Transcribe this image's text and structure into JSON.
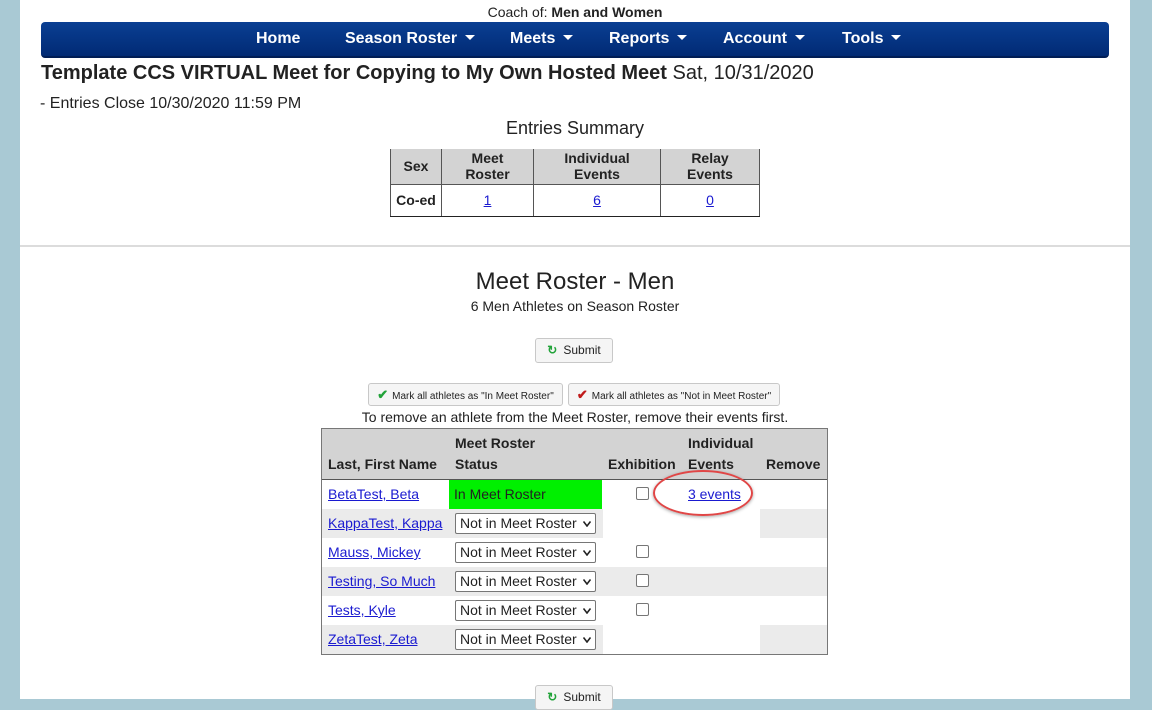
{
  "header": {
    "coach_prefix": "Coach of:",
    "coach_value": "Men and Women"
  },
  "nav": {
    "items": [
      {
        "label": "Home",
        "dropdown": false
      },
      {
        "label": "Season Roster",
        "dropdown": true
      },
      {
        "label": "Meets",
        "dropdown": true
      },
      {
        "label": "Reports",
        "dropdown": true
      },
      {
        "label": "Account",
        "dropdown": true
      },
      {
        "label": "Tools",
        "dropdown": true
      }
    ]
  },
  "meet": {
    "title": "Template CCS VIRTUAL Meet for Copying to My Own Hosted Meet",
    "date": "Sat, 10/31/2020",
    "entries_close": "- Entries Close 10/30/2020 11:59 PM"
  },
  "summary": {
    "title": "Entries Summary",
    "headers": [
      "Sex",
      "Meet Roster",
      "Individual Events",
      "Relay Events"
    ],
    "row": {
      "sex": "Co-ed",
      "meet_roster": "1",
      "individual_events": "6",
      "relay_events": "0"
    }
  },
  "roster": {
    "title": "Meet Roster - Men",
    "subtitle": "6 Men Athletes on Season Roster",
    "submit_label": "Submit",
    "mark_in_label": "Mark all athletes as \"In Meet Roster\"",
    "mark_out_label": "Mark all athletes as \"Not in Meet Roster\"",
    "remove_note": "To remove an athlete from the Meet Roster, remove their events first.",
    "columns": {
      "name": "Last, First Name",
      "status_line1": "Meet Roster",
      "status_line2": "Status",
      "exhibition": "Exhibition",
      "events_line1": "Individual",
      "events_line2": "Events",
      "remove": "Remove"
    },
    "athletes": [
      {
        "name": "BetaTest, Beta",
        "status": "In Meet Roster",
        "events": "3 events"
      },
      {
        "name": "KappaTest, Kappa",
        "status": "Not in Meet Roster",
        "events": ""
      },
      {
        "name": "Mauss, Mickey",
        "status": "Not in Meet Roster",
        "events": ""
      },
      {
        "name": "Testing, So Much",
        "status": "Not in Meet Roster",
        "events": ""
      },
      {
        "name": "Tests, Kyle",
        "status": "Not in Meet Roster",
        "events": ""
      },
      {
        "name": "ZetaTest, Zeta",
        "status": "Not in Meet Roster",
        "events": ""
      }
    ]
  },
  "colors": {
    "nav_bg": "#012a74",
    "in_roster_green": "#00f000",
    "highlight_ring": "#e04646",
    "link": "#1a1ad0"
  }
}
